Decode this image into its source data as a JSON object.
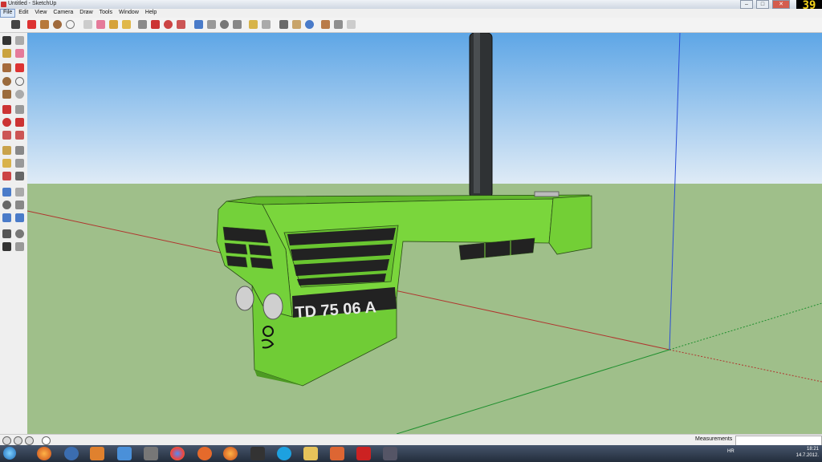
{
  "window": {
    "title": "Untitled - SketchUp",
    "fps": "39"
  },
  "menubar": {
    "items": [
      "File",
      "Edit",
      "View",
      "Camera",
      "Draw",
      "Tools",
      "Window",
      "Help"
    ],
    "active": "File"
  },
  "model": {
    "plate_text": "TD 75 06 A"
  },
  "statusbar": {
    "measurements_label": "Measurements"
  },
  "taskbar": {
    "language": "HR",
    "time": "18:21",
    "date": "14.7.2012."
  },
  "colors": {
    "sky_top": "#6aaee7",
    "sky_bottom": "#dbe9f6",
    "ground": "#9fbf8a",
    "tractor_green": "#7ad63c",
    "red_axis": "#b0352e",
    "blue_axis": "#2c4fd6",
    "green_axis": "#1f8f2e"
  }
}
